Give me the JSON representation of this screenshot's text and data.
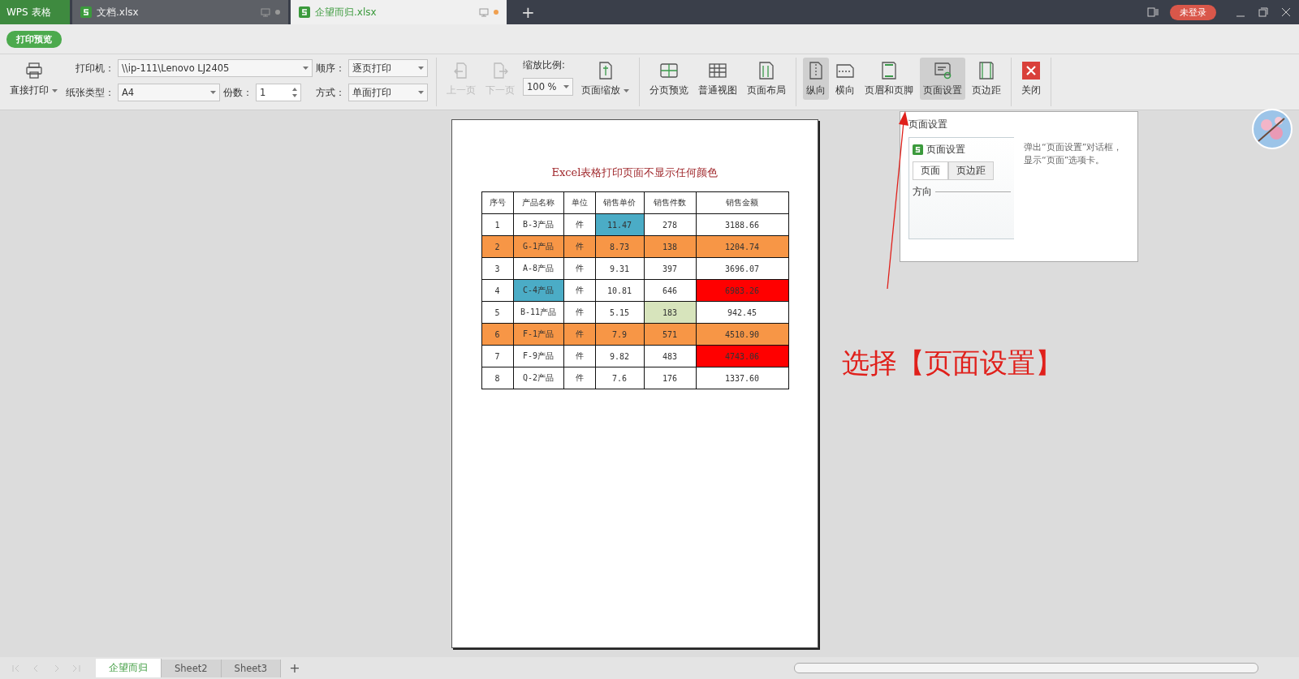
{
  "title_bar": {
    "app_label": "WPS 表格",
    "tabs": [
      {
        "label": "文档.xlsx",
        "selected": false
      },
      {
        "label": "企望而归.xlsx",
        "selected": true
      }
    ],
    "new_tab": "+",
    "login_badge": "未登录"
  },
  "mode_button": "打印预览",
  "print_button": {
    "label": "直接打印"
  },
  "print_form": {
    "printer_label": "打印机：",
    "printer": "\\\\ip-111\\Lenovo LJ2405",
    "order_label": "顺序：",
    "order": "逐页打印",
    "paper_label": "纸张类型：",
    "paper": "A4",
    "copies_label": "份数：",
    "copies": "1",
    "mode_label": "方式：",
    "mode": "单面打印"
  },
  "nav_buttons": [
    {
      "label": "上一页",
      "disabled": true
    },
    {
      "label": "下一页",
      "disabled": true
    }
  ],
  "zoom": {
    "label": "缩放比例:",
    "value": "100 %",
    "scale_button": "页面缩放"
  },
  "view_tools": [
    {
      "label": "分页预览",
      "active": false
    },
    {
      "label": "普通视图",
      "active": false
    },
    {
      "label": "页面布局",
      "active": false
    }
  ],
  "page_tools": [
    {
      "label": "纵向",
      "active": true
    },
    {
      "label": "横向",
      "active": false
    },
    {
      "label": "页眉和页脚",
      "active": false
    },
    {
      "label": "页面设置",
      "active": true
    },
    {
      "label": "页边距",
      "active": false
    }
  ],
  "close_tool": {
    "label": "关闭"
  },
  "preview_page": {
    "title": "Excel表格打印页面不显示任何颜色",
    "columns": [
      "序号",
      "产品名称",
      "单位",
      "销售单价",
      "销售件数",
      "销售金额"
    ],
    "rows": [
      {
        "cells": [
          "1",
          "B-3产品",
          "件",
          {
            "text": "11.47",
            "color": "#4bacc6"
          },
          "278",
          "3188.66"
        ]
      },
      {
        "color": "#f79646",
        "cells": [
          "2",
          "G-1产品",
          "件",
          "8.73",
          "138",
          "1204.74"
        ]
      },
      {
        "cells": [
          "3",
          "A-8产品",
          "件",
          "9.31",
          "397",
          "3696.07"
        ]
      },
      {
        "cells": [
          "4",
          {
            "text": "C-4产品",
            "color": "#4bacc6"
          },
          "件",
          "10.81",
          "646",
          {
            "text": "6983.26",
            "color": "#ff0000"
          }
        ]
      },
      {
        "cells": [
          "5",
          "B-11产品",
          "件",
          "5.15",
          {
            "text": "183",
            "color": "#d7e4bc"
          },
          "942.45"
        ]
      },
      {
        "color": "#f79646",
        "cells": [
          "6",
          "F-1产品",
          "件",
          "7.9",
          "571",
          "4510.90"
        ]
      },
      {
        "cells": [
          "7",
          "F-9产品",
          "件",
          "9.82",
          "483",
          {
            "text": "4743.06",
            "color": "#ff0000"
          }
        ]
      },
      {
        "cells": [
          "8",
          "Q-2产品",
          "件",
          "7.6",
          "176",
          "1337.60"
        ]
      }
    ]
  },
  "tooltip": {
    "title": "页面设置",
    "dialog_title": "页面设置",
    "dialog_tabs": [
      {
        "label": "页面",
        "selected": true
      },
      {
        "label": "页边距",
        "selected": false
      }
    ],
    "section": "方向",
    "description": "弹出“页面设置”对话框，显示“页面”选项卡。"
  },
  "annotation": "选择【页面设置】",
  "sheet_tabs": [
    {
      "label": "企望而归",
      "selected": true
    },
    {
      "label": "Sheet2",
      "selected": false
    },
    {
      "label": "Sheet3",
      "selected": false
    }
  ],
  "add_sheet": "+"
}
